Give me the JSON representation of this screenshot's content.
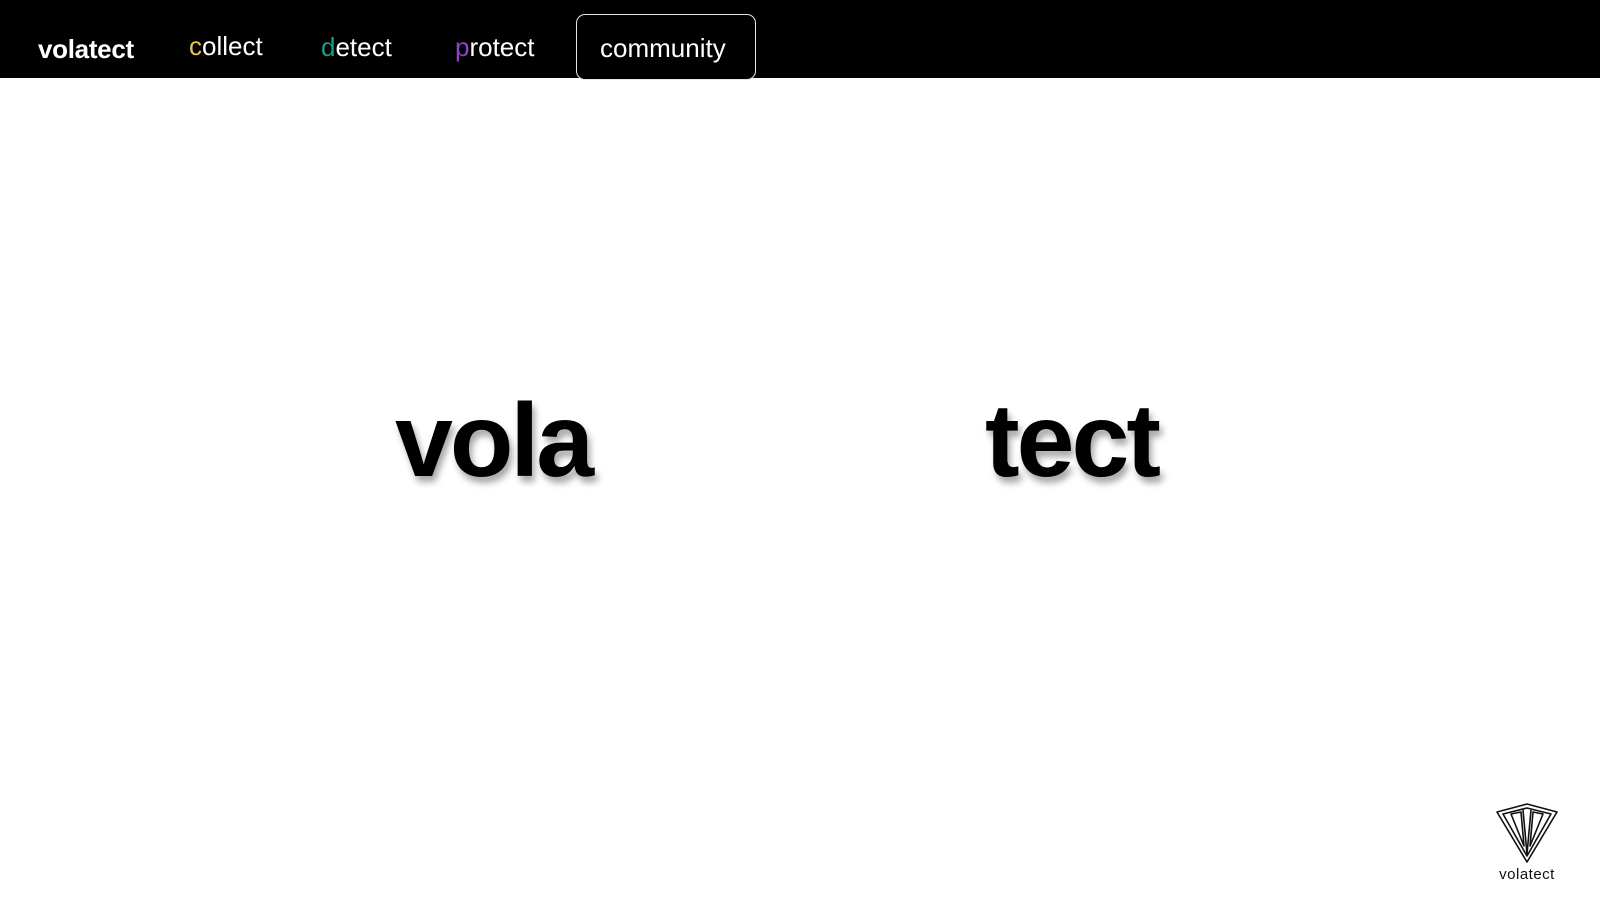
{
  "nav": {
    "brand": "volatect",
    "items": [
      {
        "first_letter": "c",
        "rest": "ollect",
        "accent": "#e6c34a"
      },
      {
        "first_letter": "d",
        "rest": "etect",
        "accent": "#1a9a8a"
      },
      {
        "first_letter": "p",
        "rest": "rotect",
        "accent": "#8e44c4"
      }
    ],
    "community": "community"
  },
  "hero": {
    "left_word": "vola",
    "right_word": "tect"
  },
  "logo": {
    "text": "volatect",
    "icon": "shield-logo-icon"
  },
  "colors": {
    "topbar": "#000000",
    "background": "#ffffff"
  }
}
